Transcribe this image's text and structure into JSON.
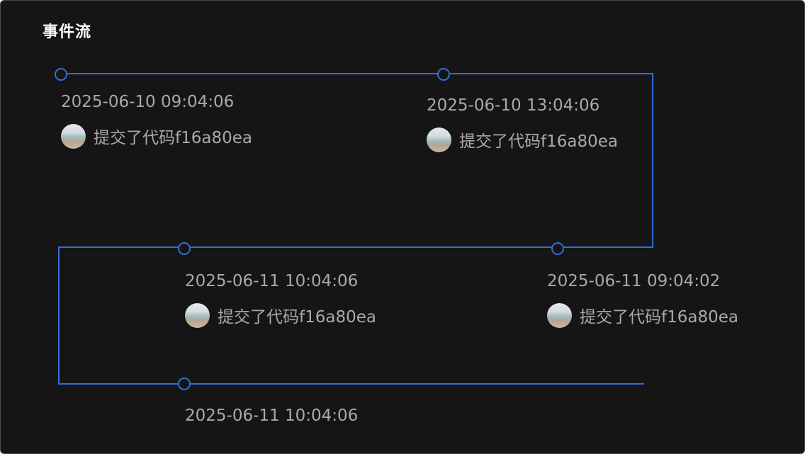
{
  "title": "事件流",
  "events": [
    {
      "time": "2025-06-10 09:04:06",
      "description": "提交了代码f16a80ea",
      "avatar": "user-avatar"
    },
    {
      "time": "2025-06-10 13:04:06",
      "description": "提交了代码f16a80ea",
      "avatar": "user-avatar"
    },
    {
      "time": "2025-06-11 10:04:06",
      "description": "提交了代码f16a80ea",
      "avatar": "user-avatar"
    },
    {
      "time": "2025-06-11 09:04:02",
      "description": "提交了代码f16a80ea",
      "avatar": "user-avatar"
    },
    {
      "time": "2025-06-11 10:04:06"
    }
  ],
  "colors": {
    "background": "#151515",
    "line": "#2f6fd6",
    "text": "#a9a9a9",
    "title": "#ffffff"
  }
}
